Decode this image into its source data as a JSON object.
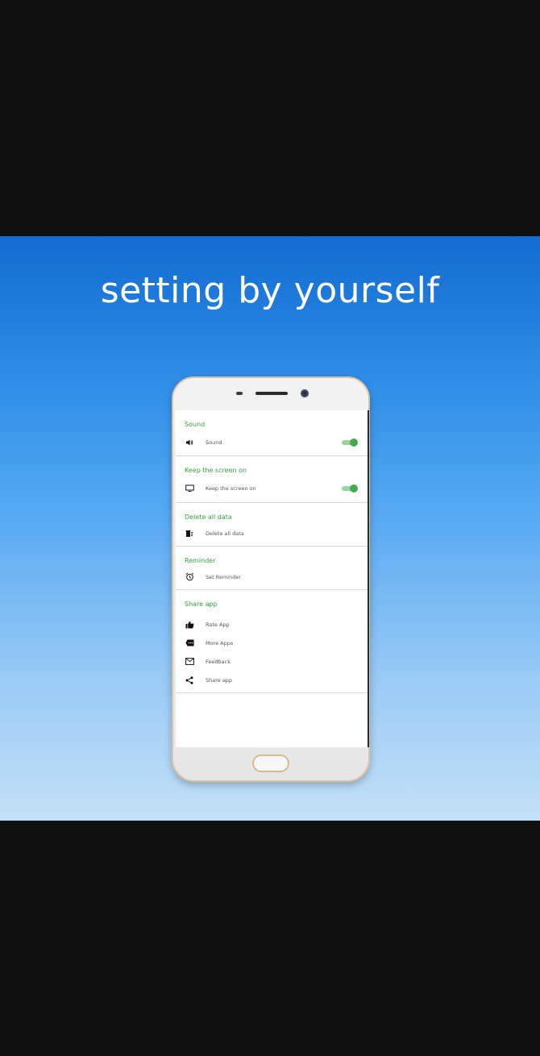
{
  "banner": {
    "headline": "setting by yourself"
  },
  "app": {
    "accent_color": "#35a245",
    "sections": [
      {
        "title": "Sound",
        "rows": [
          {
            "icon": "speaker-icon",
            "label": "Sound",
            "toggle": true,
            "toggle_on": true
          }
        ]
      },
      {
        "title": "Keep the screen on",
        "rows": [
          {
            "icon": "monitor-icon",
            "label": "Keep the screen on",
            "toggle": true,
            "toggle_on": true
          }
        ]
      },
      {
        "title": "Delete all data",
        "rows": [
          {
            "icon": "delete-data-icon",
            "label": "Delete all data"
          }
        ]
      },
      {
        "title": "Reminder",
        "rows": [
          {
            "icon": "alarm-clock-icon",
            "label": "Set Reminder"
          }
        ]
      },
      {
        "title": "Share app",
        "rows": [
          {
            "icon": "thumbs-up-icon",
            "label": "Rate App"
          },
          {
            "icon": "more-apps-icon",
            "label": "More Apps"
          },
          {
            "icon": "mail-icon",
            "label": "Feedback"
          },
          {
            "icon": "share-icon",
            "label": "Share app"
          }
        ]
      }
    ]
  }
}
